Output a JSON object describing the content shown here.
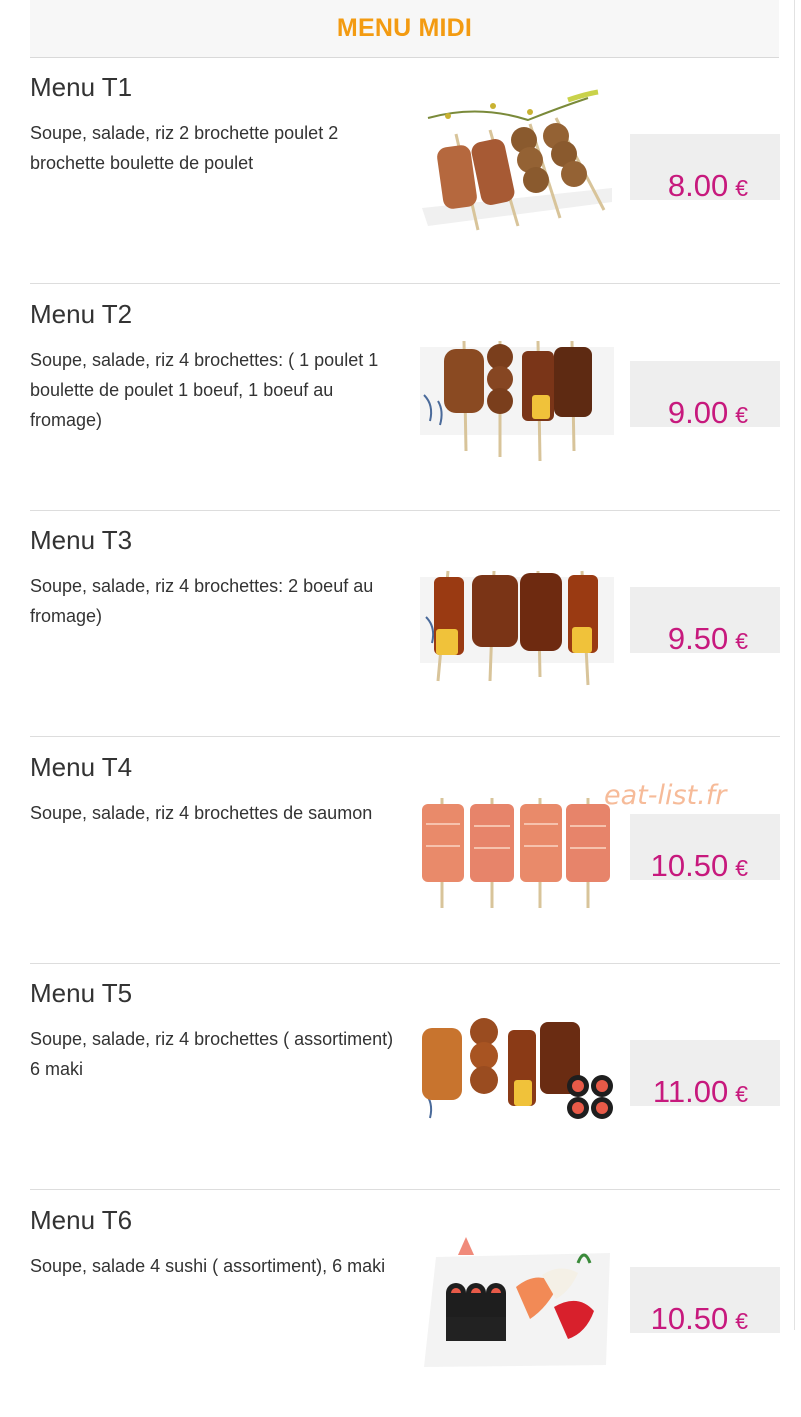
{
  "header": {
    "title": "MENU MIDI"
  },
  "currency_symbol": "€",
  "watermark": "eat-list.fr",
  "colors": {
    "title": "#f39b12",
    "price": "#c7197d",
    "price_box": "#eeeeee"
  },
  "items": [
    {
      "name": "Menu T1",
      "description": "Soupe, salade, riz 2 brochette poulet 2 brochette boulette de poulet",
      "price": "8.00",
      "image": "yakitori-chicken-skewers"
    },
    {
      "name": "Menu T2",
      "description": "Soupe, salade, riz 4 brochettes: ( 1 poulet 1 boulette de poulet 1 boeuf, 1 boeuf au fromage)",
      "price": "9.00",
      "image": "yakitori-mixed-skewers"
    },
    {
      "name": "Menu T3",
      "description": "Soupe, salade, riz 4 brochettes: 2 boeuf au fromage)",
      "price": "9.50",
      "image": "yakitori-beef-cheese-skewers"
    },
    {
      "name": "Menu T4",
      "description": "Soupe, salade, riz 4 brochettes de saumon",
      "price": "10.50",
      "image": "salmon-skewers"
    },
    {
      "name": "Menu T5",
      "description": "Soupe, salade, riz 4 brochettes ( assortiment) 6 maki",
      "price": "11.00",
      "image": "skewers-and-maki"
    },
    {
      "name": "Menu T6",
      "description": "Soupe, salade 4 sushi ( assortiment), 6 maki",
      "price": "10.50",
      "image": "sushi-and-maki-plate"
    }
  ]
}
